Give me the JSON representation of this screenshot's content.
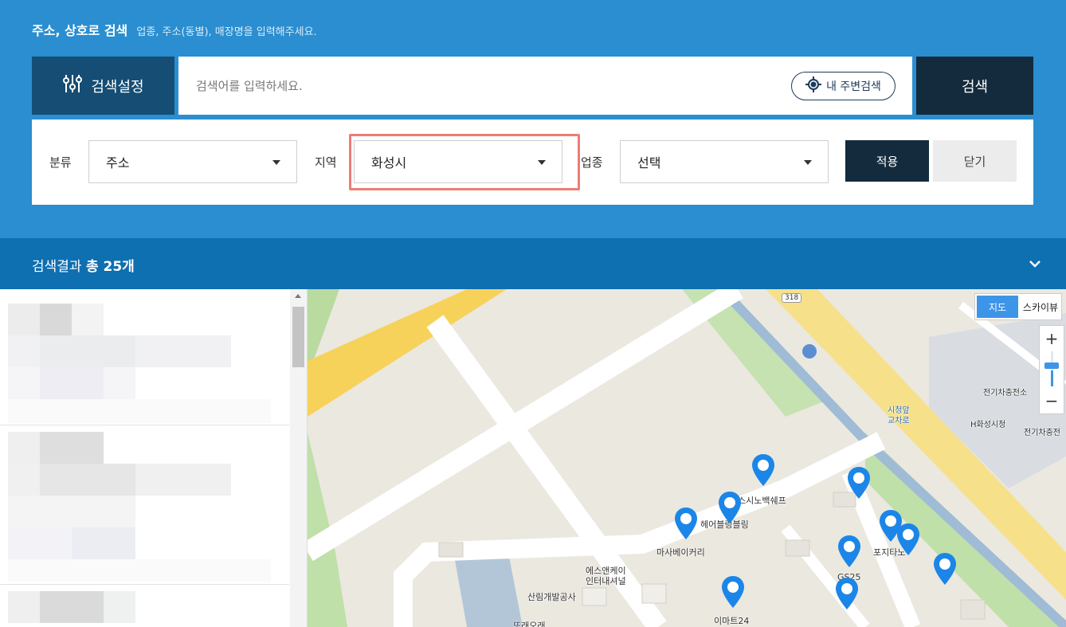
{
  "header": {
    "title": "주소, 상호로 검색",
    "hint": "업종, 주소(동별), 매장명을 입력해주세요."
  },
  "search": {
    "settings_label": "검색설정",
    "placeholder": "검색어를 입력하세요.",
    "value": "",
    "nearby_label": "내 주변검색",
    "submit_label": "검색"
  },
  "filters": {
    "category": {
      "label": "분류",
      "value": "주소"
    },
    "region": {
      "label": "지역",
      "value": "화성시"
    },
    "business": {
      "label": "업종",
      "value": "선택"
    },
    "apply_label": "적용",
    "close_label": "닫기"
  },
  "results": {
    "prefix": "검색결과",
    "total": "총 25개"
  },
  "map": {
    "type_options": [
      "지도",
      "스카이뷰"
    ],
    "active_type": "지도",
    "zoom_in": "+",
    "zoom_out": "−",
    "route_number": "318",
    "places": [
      "스시노백쉐프",
      "헤어블링블링",
      "마사베이커리",
      "에스앤케이",
      "인터내셔널",
      "산림개발공사",
      "또래오래",
      "이마트24",
      "GS25",
      "포지타노",
      "전기차충전소",
      "H화성시청",
      "전기차충전",
      "시청앞",
      "교차로"
    ]
  },
  "colors": {
    "panel_blue": "#2a8ed0",
    "result_bar": "#0e6fb1",
    "dark_navy": "#132b3d",
    "settings_navy": "#154d74",
    "highlight": "#ee7c77",
    "pin_blue": "#1b86e8"
  }
}
